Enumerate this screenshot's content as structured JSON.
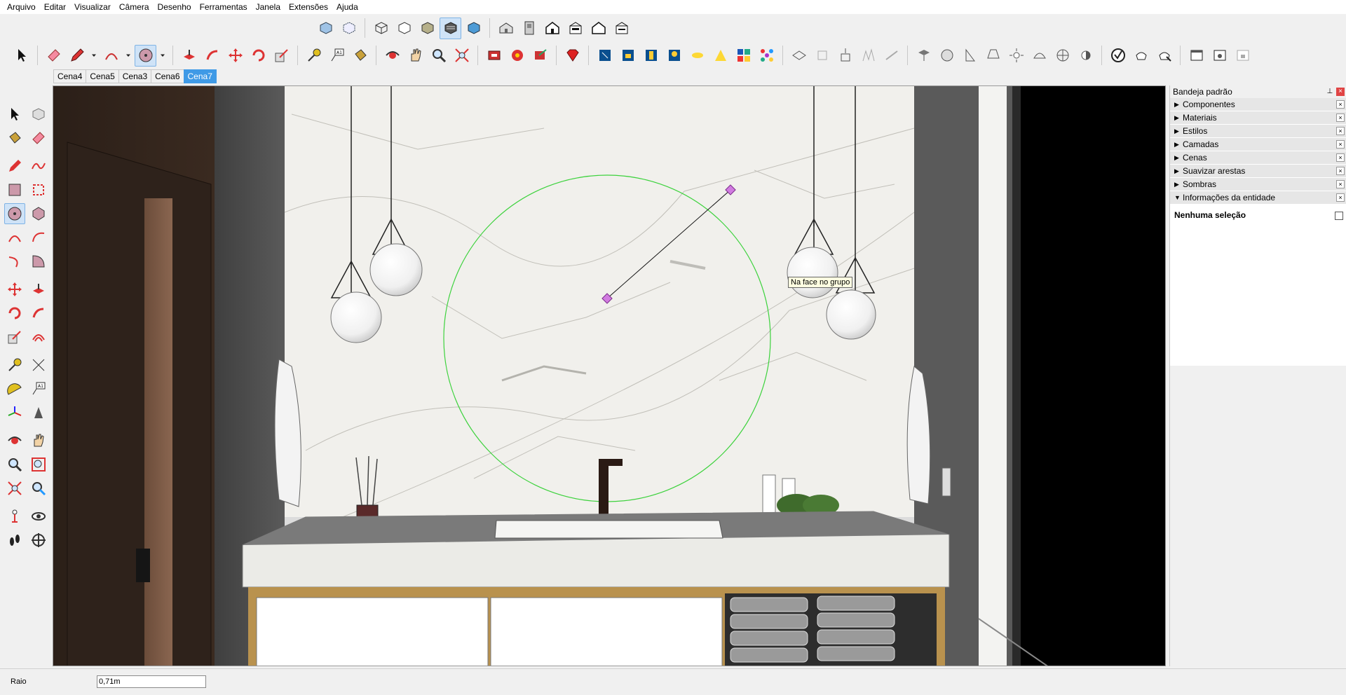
{
  "menu": [
    "Arquivo",
    "Editar",
    "Visualizar",
    "Câmera",
    "Desenho",
    "Ferramentas",
    "Janela",
    "Extensões",
    "Ajuda"
  ],
  "scenes": {
    "tabs": [
      "Cena4",
      "Cena5",
      "Cena3",
      "Cena6",
      "Cena7"
    ],
    "active": "Cena7"
  },
  "viewport": {
    "inference_tooltip": "Na face no grupo",
    "colors": {
      "circle": "#3cd23c",
      "vertex": "#d17be0",
      "marble": "#f1f0ec",
      "wall": "#4a4a4a",
      "counter": "#ebebe7"
    }
  },
  "tray": {
    "title": "Bandeja padrão",
    "panels": [
      {
        "label": "Componentes",
        "expanded": false
      },
      {
        "label": "Materiais",
        "expanded": false
      },
      {
        "label": "Estilos",
        "expanded": false
      },
      {
        "label": "Camadas",
        "expanded": false
      },
      {
        "label": "Cenas",
        "expanded": false
      },
      {
        "label": "Suavizar arestas",
        "expanded": false
      },
      {
        "label": "Sombras",
        "expanded": false
      },
      {
        "label": "Informações da entidade",
        "expanded": true
      }
    ],
    "entity_info": "Nenhuma seleção"
  },
  "status": {
    "vcb_label": "Raio",
    "vcb_value": "0,71m"
  },
  "icons": {
    "views": [
      "iso-view-icon",
      "top-view-icon",
      "front-view-icon",
      "right-view-icon",
      "back-view-icon",
      "left-view-icon"
    ],
    "styles": [
      "xray-icon",
      "back-edges-icon",
      "wireframe-icon",
      "hidden-line-icon",
      "shaded-icon",
      "shaded-textures-icon",
      "monochrome-icon"
    ]
  }
}
